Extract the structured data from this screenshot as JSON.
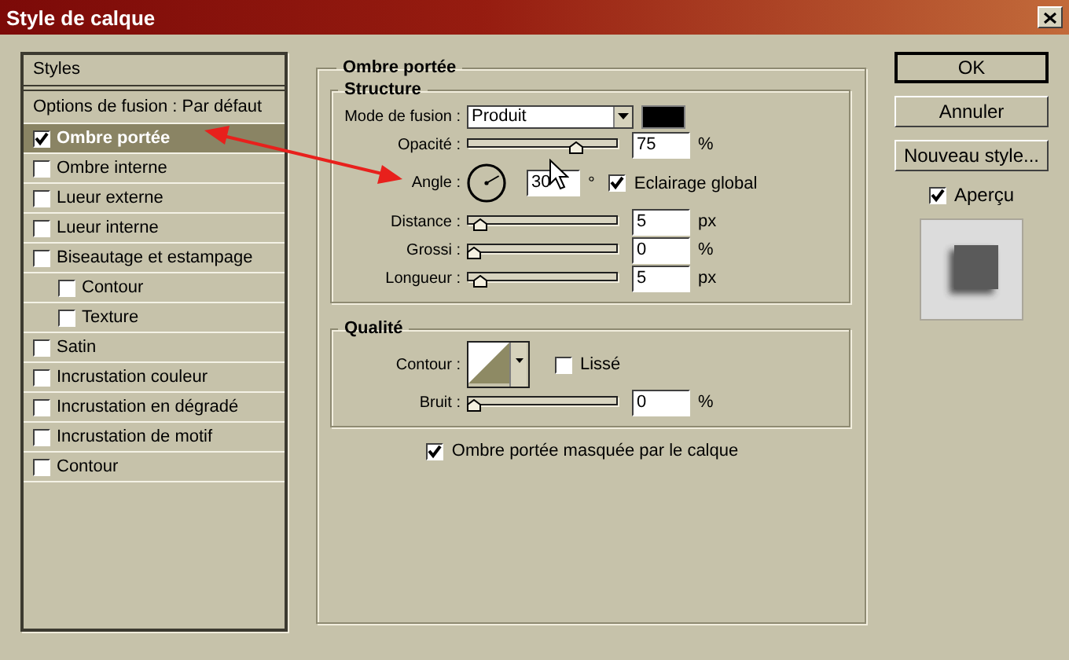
{
  "window": {
    "title": "Style de calque"
  },
  "sidebar": {
    "header": "Styles",
    "blend_options": "Options de fusion : Par défaut",
    "items": [
      {
        "label": "Ombre portée",
        "checked": true,
        "selected": true
      },
      {
        "label": "Ombre interne",
        "checked": false,
        "selected": false
      },
      {
        "label": "Lueur externe",
        "checked": false,
        "selected": false
      },
      {
        "label": "Lueur interne",
        "checked": false,
        "selected": false
      },
      {
        "label": "Biseautage et estampage",
        "checked": false,
        "selected": false,
        "children": [
          {
            "label": "Contour",
            "checked": false,
            "selected": false
          },
          {
            "label": "Texture",
            "checked": false,
            "selected": false
          }
        ]
      },
      {
        "label": "Satin",
        "checked": false,
        "selected": false
      },
      {
        "label": "Incrustation couleur",
        "checked": false,
        "selected": false
      },
      {
        "label": "Incrustation en dégradé",
        "checked": false,
        "selected": false
      },
      {
        "label": "Incrustation de motif",
        "checked": false,
        "selected": false
      },
      {
        "label": "Contour",
        "checked": false,
        "selected": false
      }
    ]
  },
  "panel": {
    "title": "Ombre portée",
    "structure": {
      "title": "Structure",
      "rows": [
        {
          "kind": "select",
          "label": "Mode de fusion :",
          "value": "Produit"
        },
        {
          "kind": "slider",
          "label": "Opacité :",
          "level": 0.75,
          "value": "75",
          "unit": "%"
        },
        {
          "kind": "angle",
          "label": "Angle :",
          "value": "30",
          "unit": "°",
          "checkbox": {
            "label": "Eclairage global",
            "checked": true
          }
        },
        {
          "kind": "slider",
          "label": "Distance :",
          "level": 0.05,
          "value": "5",
          "unit": "px"
        },
        {
          "kind": "slider",
          "label": "Grossi :",
          "level": 0,
          "value": "0",
          "unit": "%"
        },
        {
          "kind": "slider",
          "label": "Longueur :",
          "level": 0.05,
          "value": "5",
          "unit": "px"
        }
      ]
    },
    "quality": {
      "title": "Qualité",
      "rows": [
        {
          "kind": "contour",
          "label": "Contour :",
          "checkbox": {
            "label": "Lissé",
            "checked": false
          }
        },
        {
          "kind": "slider",
          "label": "Bruit :",
          "level": 0,
          "value": "0",
          "unit": "%"
        }
      ]
    },
    "footer_checkbox": {
      "label": "Ombre portée masquée par le calque",
      "checked": true
    }
  },
  "buttons": [
    {
      "label": "OK",
      "default": true
    },
    {
      "label": "Annuler",
      "default": false
    },
    {
      "label": "Nouveau style...",
      "default": false
    }
  ],
  "preview": {
    "label": "Aperçu",
    "checked": true
  }
}
